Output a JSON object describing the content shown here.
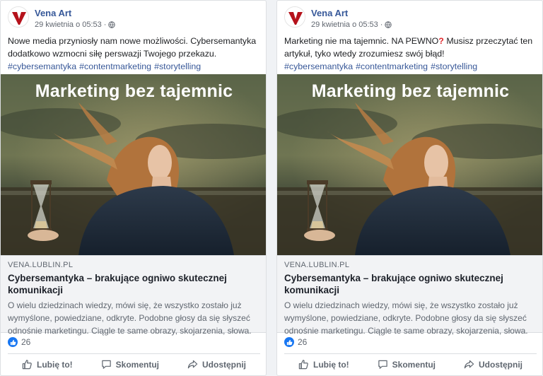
{
  "colors": {
    "author": "#365899",
    "hashtag": "#385898",
    "like_blue": "#1877f2",
    "question_red": "#e0272b"
  },
  "posts": [
    {
      "author": "Vena Art",
      "date": "29 kwietnia o 05:53",
      "separator": "·",
      "audience_icon": "globe-icon",
      "text_1": "Nowe media przyniosły nam nowe możliwości. Cybersemantyka dodatkowo wzmocni siłę perswazji Twojego przekazu.",
      "text_mark": "",
      "text_2": "",
      "hashtags": [
        "#cybersemantyka",
        "#contentmarketing",
        "#storytelling"
      ],
      "image_headline": "Marketing bez tajemnic",
      "link": {
        "domain": "VENA.LUBLIN.PL",
        "title": "Cybersemantyka – brakujące ogniwo skutecznej komunikacji",
        "description": "O wielu dziedzinach wiedzy, mówi się, że wszystko zostało już wymyślone, powiedziane, odkryte. Podobne głosy da się słyszeć odnośnie marketingu. Ciągle te same obrazy, skojarzenia, słowa."
      },
      "reaction_count": "26",
      "actions": {
        "like": "Lubię to!",
        "comment": "Skomentuj",
        "share": "Udostępnij"
      }
    },
    {
      "author": "Vena Art",
      "date": "29 kwietnia o 05:53",
      "separator": "·",
      "audience_icon": "globe-icon",
      "text_1": "Marketing nie ma tajemnic. NA PEWNO",
      "text_mark": "?",
      "text_2": " Musisz przeczytać ten artykuł, tyko wtedy zrozumiesz swój błąd!",
      "hashtags": [
        "#cybersemantyka",
        "#contentmarketing",
        "#storytelling"
      ],
      "image_headline": "Marketing bez tajemnic",
      "link": {
        "domain": "VENA.LUBLIN.PL",
        "title": "Cybersemantyka – brakujące ogniwo skutecznej komunikacji",
        "description": "O wielu dziedzinach wiedzy, mówi się, że wszystko zostało już wymyślone, powiedziane, odkryte. Podobne głosy da się słyszeć odnośnie marketingu. Ciągle te same obrazy, skojarzenia, słowa."
      },
      "reaction_count": "26",
      "actions": {
        "like": "Lubię to!",
        "comment": "Skomentuj",
        "share": "Udostępnij"
      }
    }
  ]
}
